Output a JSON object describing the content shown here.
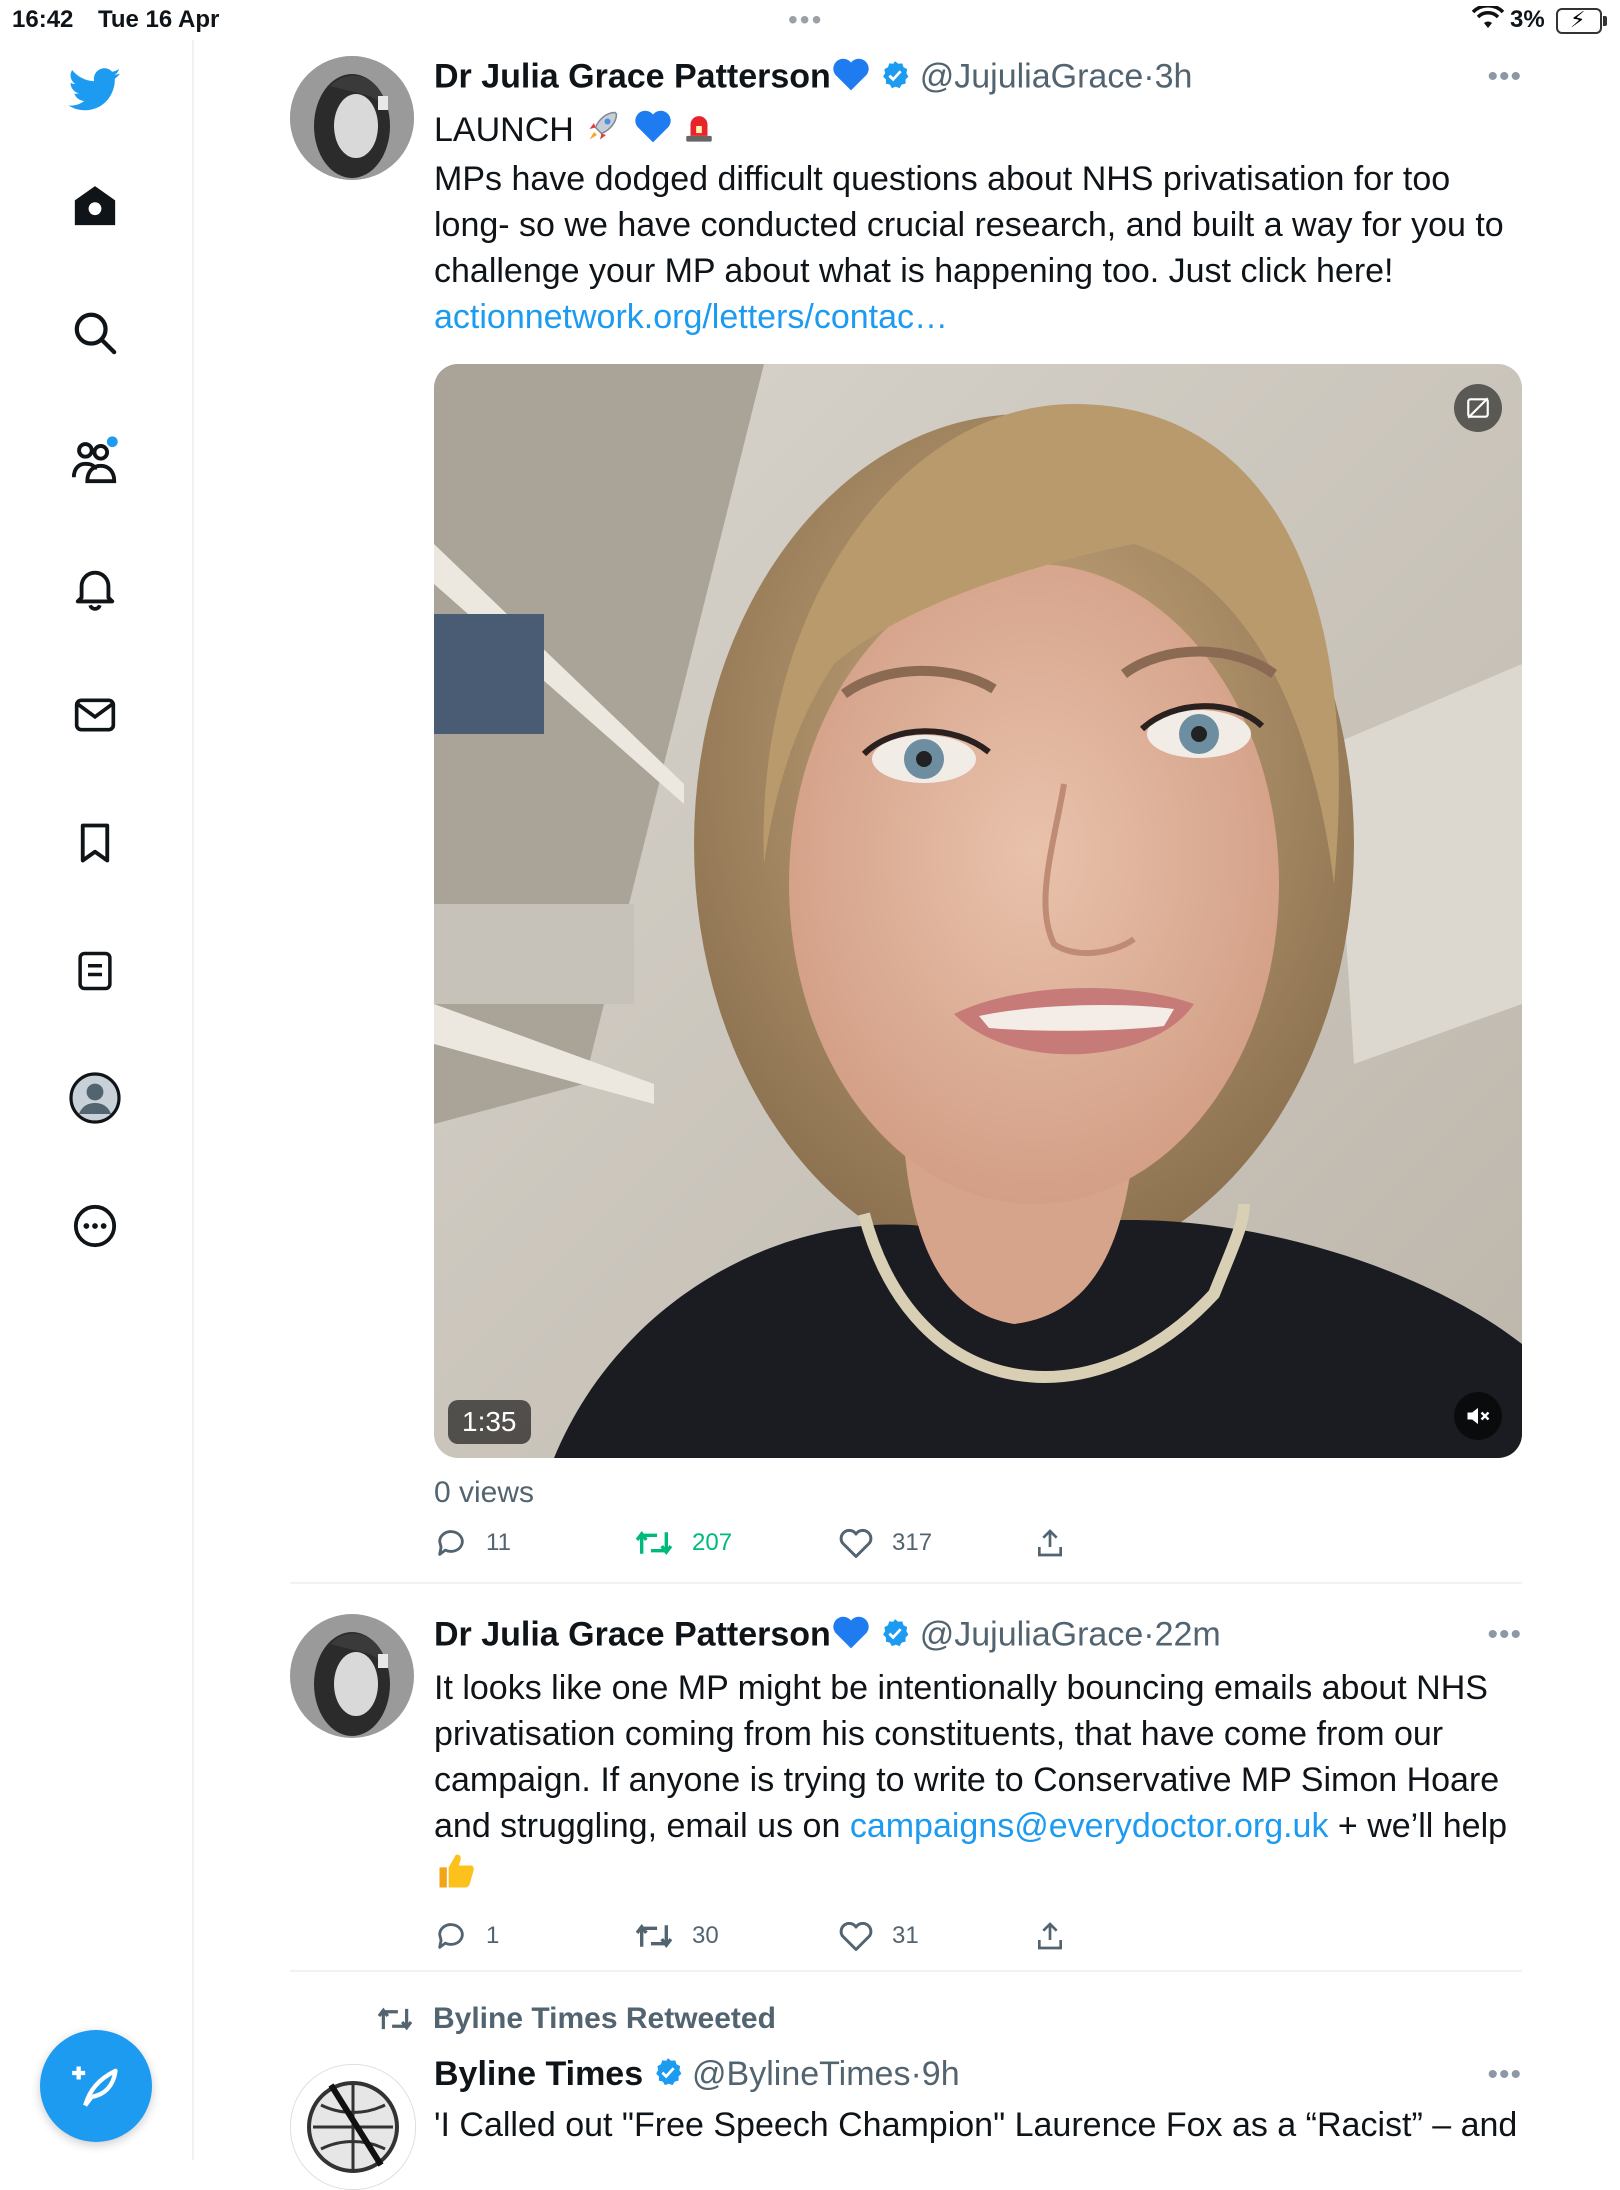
{
  "status_bar": {
    "time": "16:42",
    "date": "Tue 16 Apr",
    "battery": "3%"
  },
  "sidebar": {
    "items": [
      "twitter-logo",
      "home",
      "explore",
      "communities",
      "notifications",
      "messages",
      "bookmarks",
      "lists",
      "profile",
      "more"
    ]
  },
  "colors": {
    "accent": "#1d9bf0",
    "retweet_green": "#00ba7c",
    "muted": "#536471"
  },
  "tweets": [
    {
      "name": "Dr Julia Grace Patterson",
      "handle": "@JujuliaGrace",
      "sep": "·",
      "time": "3h",
      "line1": "LAUNCH",
      "text": "MPs have dodged difficult questions about NHS privatisation for too long- so we have conducted crucial research, and built a way for you to challenge your MP about what is happening too. Just click here!",
      "link": "actionnetwork.org/letters/contac…",
      "video_duration": "1:35",
      "views": "0 views",
      "replies": "11",
      "retweets": "207",
      "likes": "317"
    },
    {
      "name": "Dr Julia Grace Patterson",
      "handle": "@JujuliaGrace",
      "sep": "·",
      "time": "22m",
      "text_before": "It looks like one MP might be intentionally bouncing emails about NHS privatisation coming from his constituents, that have come from our campaign. If anyone is trying to write to Conservative MP Simon Hoare and struggling, email us on ",
      "email": "campaigns@everydoctor.org.uk",
      "text_after": " + we’ll help",
      "replies": "1",
      "retweets": "30",
      "likes": "31"
    },
    {
      "retweeted_by": "Byline Times Retweeted",
      "name": "Byline Times",
      "handle": "@BylineTimes",
      "sep": "·",
      "time": "9h",
      "text": "'I Called out \"Free Speech Champion\" Laurence Fox as a “Racist” – and"
    }
  ]
}
